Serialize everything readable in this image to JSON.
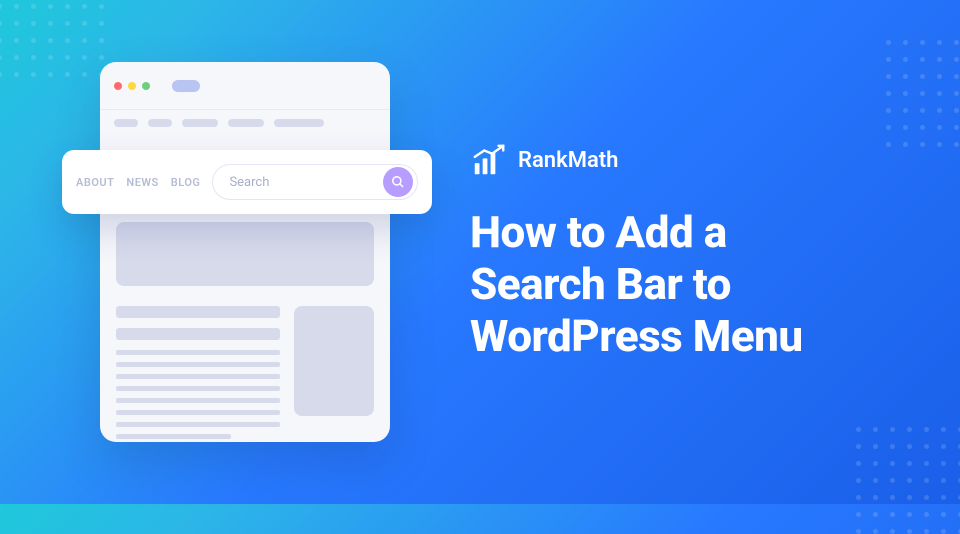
{
  "brand": {
    "name": "RankMath"
  },
  "title": "How to Add a Search Bar to WordPress Menu",
  "illustration": {
    "nav": {
      "items": [
        "ABOUT",
        "NEWS",
        "BLOG"
      ],
      "search_placeholder": "Search"
    }
  },
  "colors": {
    "accent_purple": "#b79dff",
    "bg_gradient_start": "#1fc8db",
    "bg_gradient_end": "#1a5fe8"
  }
}
